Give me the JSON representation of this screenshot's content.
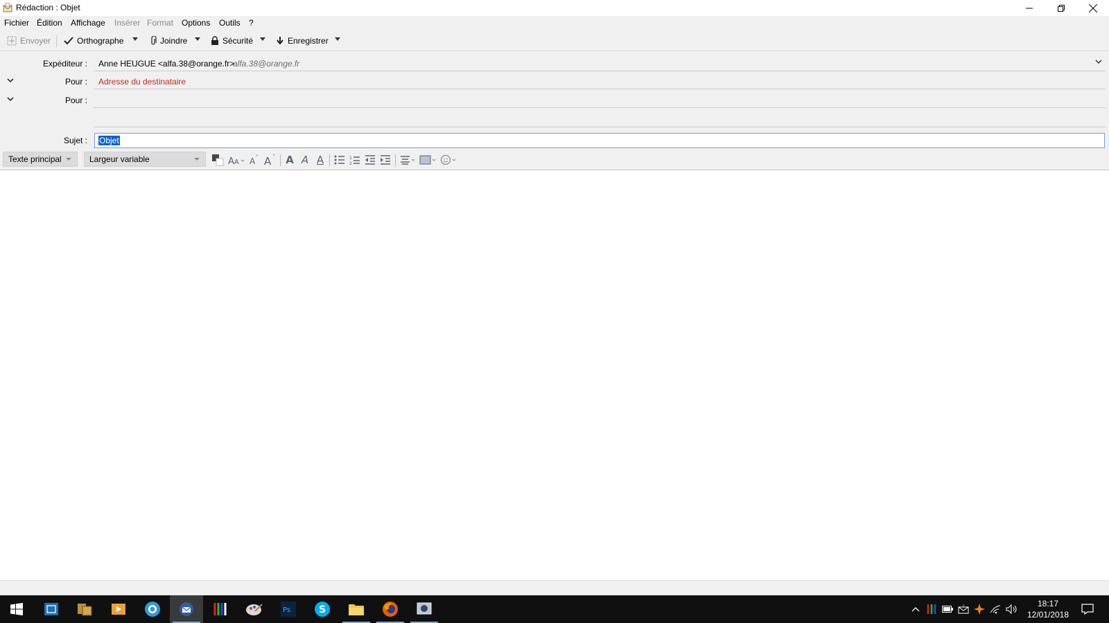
{
  "window": {
    "title": "Rédaction : Objet"
  },
  "menu": {
    "items": [
      {
        "label": "Fichier",
        "enabled": true
      },
      {
        "label": "Édition",
        "enabled": true
      },
      {
        "label": "Affichage",
        "enabled": true
      },
      {
        "label": "Insérer",
        "enabled": false
      },
      {
        "label": "Format",
        "enabled": false
      },
      {
        "label": "Options",
        "enabled": true
      },
      {
        "label": "Outils",
        "enabled": true
      },
      {
        "label": "?",
        "enabled": true
      }
    ]
  },
  "toolbar": {
    "send_label": "Envoyer",
    "spell_label": "Orthographe",
    "attach_label": "Joindre",
    "security_label": "Sécurité",
    "save_label": "Enregistrer"
  },
  "headers": {
    "from_label": "Expéditeur :",
    "from_value": "Anne HEUGUE <alfa.38@orange.fr>",
    "from_alias": "alfa.38@orange.fr",
    "to_label_1": "Pour :",
    "to_placeholder": "Adresse du destinataire",
    "to_label_2": "Pour :",
    "subject_label": "Sujet :",
    "subject_value": "Objet"
  },
  "format": {
    "paragraph_style": "Texte principal",
    "font": "Largeur variable"
  },
  "clock": {
    "time": "18:17",
    "date": "12/01/2018"
  },
  "colors": {
    "chrome": "#f0f0f0",
    "placeholder_red": "#c42b1c",
    "selection_blue": "#0a64c8",
    "taskbar": "#101010"
  },
  "icons": {
    "taskbar": [
      "windows-start-icon",
      "task-view-icon",
      "app-icon",
      "media-player-icon",
      "search-icon",
      "thunderbird-icon",
      "color-app-icon",
      "paint-icon",
      "photoshop-icon",
      "skype-icon",
      "file-explorer-icon",
      "firefox-icon",
      "settings-app-icon"
    ],
    "tray": [
      "chevron-up-icon",
      "color-tray-icon",
      "battery-icon",
      "mail-icon",
      "avast-icon",
      "wifi-icon",
      "volume-icon",
      "notification-icon"
    ]
  }
}
